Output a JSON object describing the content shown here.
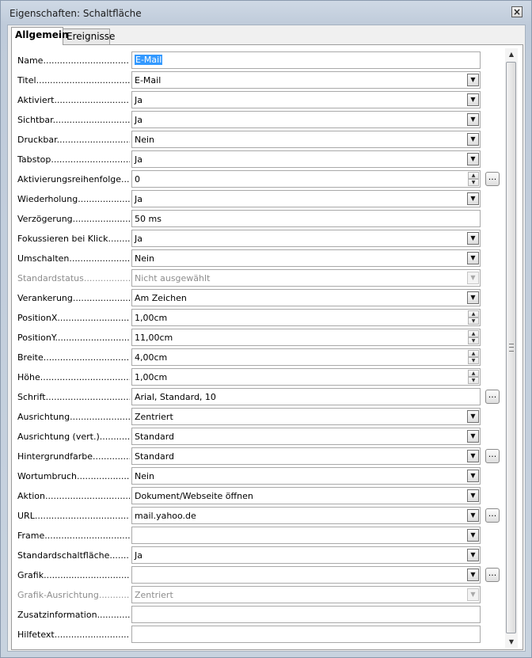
{
  "window": {
    "title": "Eigenschaften: Schaltfläche",
    "close_glyph": "×"
  },
  "tabs": [
    {
      "label": "Allgemein"
    },
    {
      "label": "Ereignisse"
    }
  ],
  "properties": [
    {
      "label": "Name",
      "value": "E-Mail",
      "control": "text",
      "selected": true
    },
    {
      "label": "Titel",
      "value": "E-Mail",
      "control": "dropdown"
    },
    {
      "label": "Aktiviert",
      "value": "Ja",
      "control": "dropdown"
    },
    {
      "label": "Sichtbar",
      "value": "Ja",
      "control": "dropdown"
    },
    {
      "label": "Druckbar",
      "value": "Nein",
      "control": "dropdown"
    },
    {
      "label": "Tabstop",
      "value": "Ja",
      "control": "dropdown"
    },
    {
      "label": "Aktivierungsreihenfolge",
      "value": "0",
      "control": "spin",
      "button": true
    },
    {
      "label": "Wiederholung",
      "value": "Ja",
      "control": "dropdown"
    },
    {
      "label": "Verzögerung",
      "value": "50 ms",
      "control": "text"
    },
    {
      "label": "Fokussieren bei Klick",
      "value": "Ja",
      "control": "dropdown"
    },
    {
      "label": "Umschalten",
      "value": "Nein",
      "control": "dropdown"
    },
    {
      "label": "Standardstatus",
      "value": "Nicht ausgewählt",
      "control": "dropdown",
      "disabled": true
    },
    {
      "label": "Verankerung",
      "value": "Am Zeichen",
      "control": "dropdown"
    },
    {
      "label": "PositionX",
      "value": "1,00cm",
      "control": "spin"
    },
    {
      "label": "PositionY",
      "value": "11,00cm",
      "control": "spin"
    },
    {
      "label": "Breite",
      "value": "4,00cm",
      "control": "spin"
    },
    {
      "label": "Höhe",
      "value": "1,00cm",
      "control": "spin"
    },
    {
      "label": "Schrift",
      "value": "Arial, Standard, 10",
      "control": "text",
      "button": true
    },
    {
      "label": "Ausrichtung",
      "value": "Zentriert",
      "control": "dropdown"
    },
    {
      "label": "Ausrichtung (vert.)",
      "value": "Standard",
      "control": "dropdown"
    },
    {
      "label": "Hintergrundfarbe",
      "value": "Standard",
      "control": "dropdown",
      "button": true
    },
    {
      "label": "Wortumbruch",
      "value": "Nein",
      "control": "dropdown"
    },
    {
      "label": "Aktion",
      "value": "Dokument/Webseite öffnen",
      "control": "dropdown"
    },
    {
      "label": "URL",
      "value": "mail.yahoo.de",
      "control": "dropdown",
      "button": true
    },
    {
      "label": "Frame",
      "value": "",
      "control": "dropdown"
    },
    {
      "label": "Standardschaltfläche",
      "value": "Ja",
      "control": "dropdown"
    },
    {
      "label": "Grafik",
      "value": "",
      "control": "dropdown",
      "button": true
    },
    {
      "label": "Grafik-Ausrichtung",
      "value": "Zentriert",
      "control": "dropdown",
      "disabled": true
    },
    {
      "label": "Zusatzinformation",
      "value": "",
      "control": "text"
    },
    {
      "label": "Hilfetext",
      "value": "",
      "control": "text"
    }
  ],
  "glyphs": {
    "dropdown": "▼",
    "spin_up": "▲",
    "spin_down": "▼",
    "more": "...",
    "scroll_up": "▲",
    "scroll_down": "▼"
  },
  "icons": {
    "dropdown": "chevron-down-icon",
    "spin": "spin-arrows-icon",
    "more": "ellipsis-icon"
  },
  "colors": {
    "selection": "#3399ff",
    "disabled_text": "#8d8d8d"
  }
}
